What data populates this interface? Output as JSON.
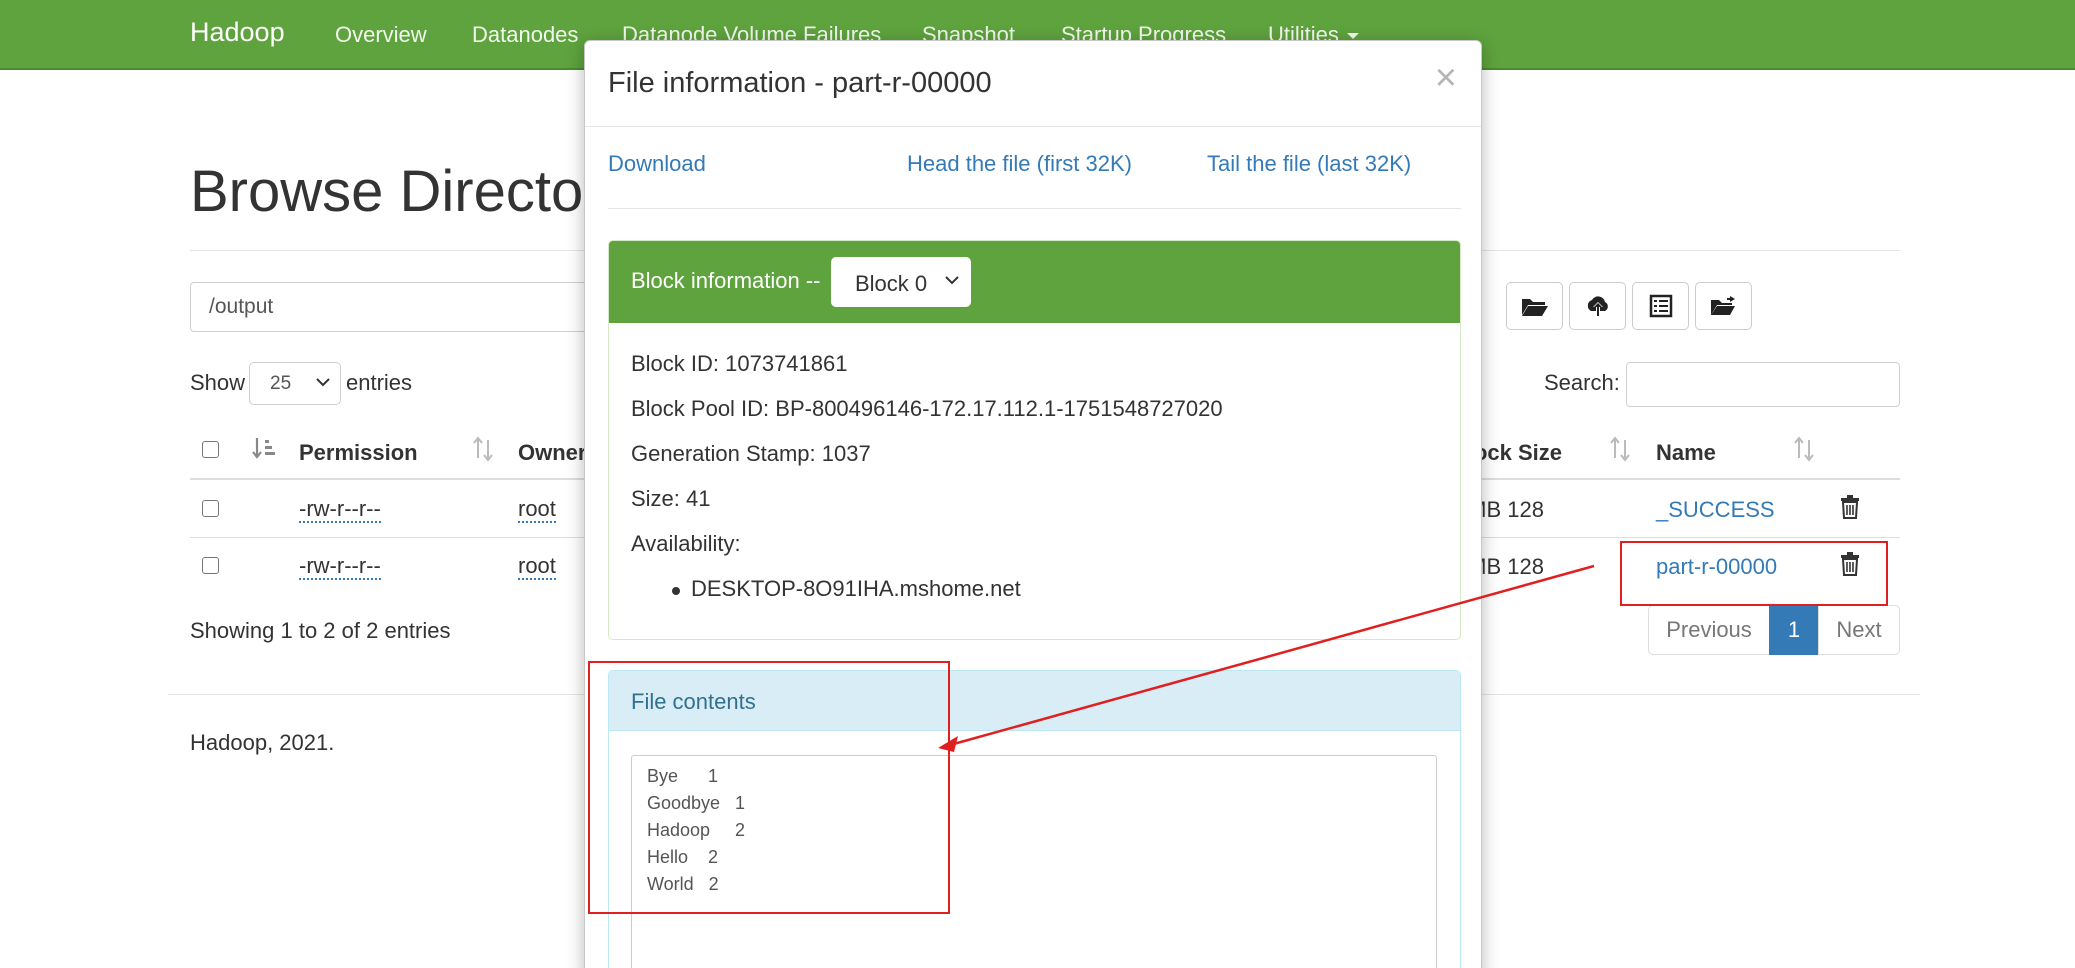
{
  "navbar": {
    "brand": "Hadoop",
    "links": [
      "Overview",
      "Datanodes",
      "Datanode Volume Failures",
      "Snapshot",
      "Startup Progress",
      "Utilities"
    ]
  },
  "page": {
    "title": "Browse Directory",
    "path": "/output",
    "show_label": "Show",
    "entries_value": "25",
    "entries_label": "entries",
    "search_label": "Search:",
    "toolbar_icons": [
      "folder-open-icon",
      "cloud-upload-icon",
      "list-alt-icon",
      "folder-move-icon"
    ]
  },
  "table": {
    "headers": {
      "permission": "Permission",
      "owner": "Owner",
      "block_size": "Block Size",
      "name": "Name"
    },
    "rows": [
      {
        "permission": "-rw-r--r--",
        "owner": "root",
        "block_size": "128 MB",
        "name": "_SUCCESS"
      },
      {
        "permission": "-rw-r--r--",
        "owner": "root",
        "block_size": "128 MB",
        "name": "part-r-00000"
      }
    ],
    "info": "Showing 1 to 2 of 2 entries"
  },
  "pagination": {
    "previous": "Previous",
    "current": "1",
    "next": "Next"
  },
  "footer": {
    "text": "Hadoop, 2021."
  },
  "modal": {
    "title": "File information - part-r-00000",
    "close": "×",
    "links": {
      "download": "Download",
      "head": "Head the file (first 32K)",
      "tail": "Tail the file (last 32K)"
    },
    "block": {
      "heading": "Block information --",
      "selected": "Block 0",
      "block_id": "Block ID: 1073741861",
      "pool_id": "Block Pool ID: BP-800496146-172.17.112.1-1751548727020",
      "generation_stamp": "Generation Stamp: 1037",
      "size": "Size: 41",
      "availability_label": "Availability:",
      "hosts": [
        "DESKTOP-8O91IHA.mshome.net"
      ]
    },
    "contents": {
      "heading": "File contents",
      "lines": [
        "Bye      1",
        "Goodbye   1",
        "Hadoop     2",
        "Hello    2",
        "World   2"
      ]
    }
  },
  "colors": {
    "navbar": "#5ea33d",
    "link": "#337ab7",
    "annotation": "#e02020",
    "info_panel": "#d9edf7"
  }
}
